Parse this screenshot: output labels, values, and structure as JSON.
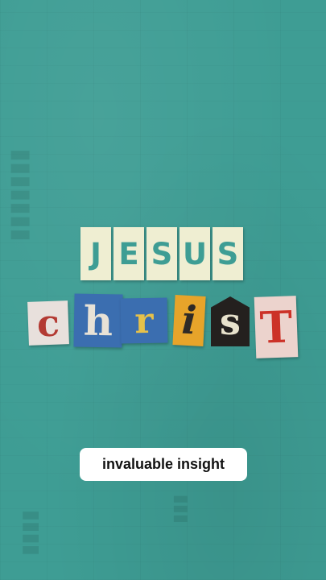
{
  "title": {
    "line1": [
      "J",
      "E",
      "S",
      "U",
      "S"
    ],
    "line2": [
      "c",
      "h",
      "r",
      "i",
      "s",
      "T"
    ]
  },
  "caption": "invaluable insight",
  "colors": {
    "background": "#3e9d94",
    "line1_tile": "#efeed2",
    "caption_pill": "#ffffff"
  }
}
